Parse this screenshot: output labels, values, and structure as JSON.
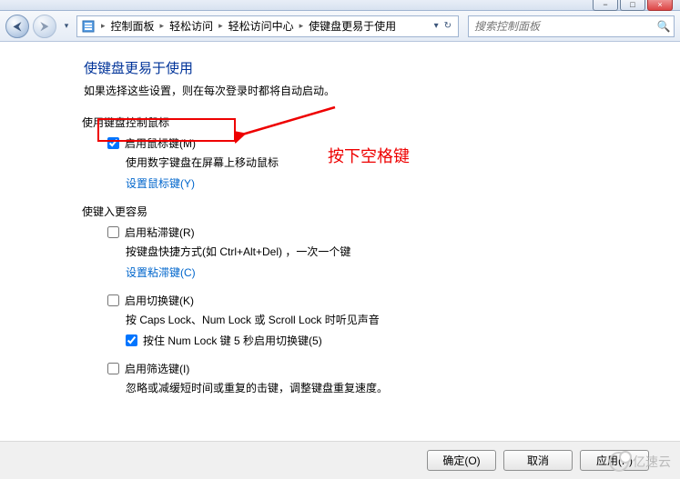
{
  "window": {
    "minimize": "−",
    "maximize": "□",
    "close": "×"
  },
  "nav": {
    "back_glyph": "⮜",
    "fwd_glyph": "⮞",
    "drop_glyph": "▾",
    "refresh_glyph": "↻"
  },
  "breadcrumb": {
    "items": [
      "控制面板",
      "轻松访问",
      "轻松访问中心",
      "使键盘更易于使用"
    ],
    "sep": "▸"
  },
  "search": {
    "placeholder": "搜索控制面板",
    "icon": "🔍"
  },
  "page": {
    "title": "使键盘更易于使用",
    "subtitle": "如果选择这些设置，则在每次登录时都将自动启动。"
  },
  "section_mouse": {
    "heading": "使用键盘控制鼠标",
    "enable_label": "启用鼠标键(M)",
    "desc": "使用数字键盘在屏幕上移动鼠标",
    "link": "设置鼠标键(Y)"
  },
  "section_typing": {
    "heading": "使键入更容易",
    "sticky": {
      "label": "启用粘滞键(R)",
      "desc": "按键盘快捷方式(如 Ctrl+Alt+Del) ，一次一个键",
      "link": "设置粘滞键(C)"
    },
    "toggle": {
      "label": "启用切换键(K)",
      "desc": "按 Caps Lock、Num Lock 或 Scroll Lock 时听见声音",
      "hold_label": "按住 Num Lock 键 5 秒启用切换键(5)"
    },
    "filter": {
      "label": "启用筛选键(I)",
      "desc": "忽略或减缓短时间或重复的击键，调整键盘重复速度。"
    }
  },
  "annotation": {
    "text": "按下空格键"
  },
  "buttons": {
    "ok": "确定(O)",
    "cancel": "取消",
    "apply": "应用(P)"
  },
  "watermark": "亿速云"
}
